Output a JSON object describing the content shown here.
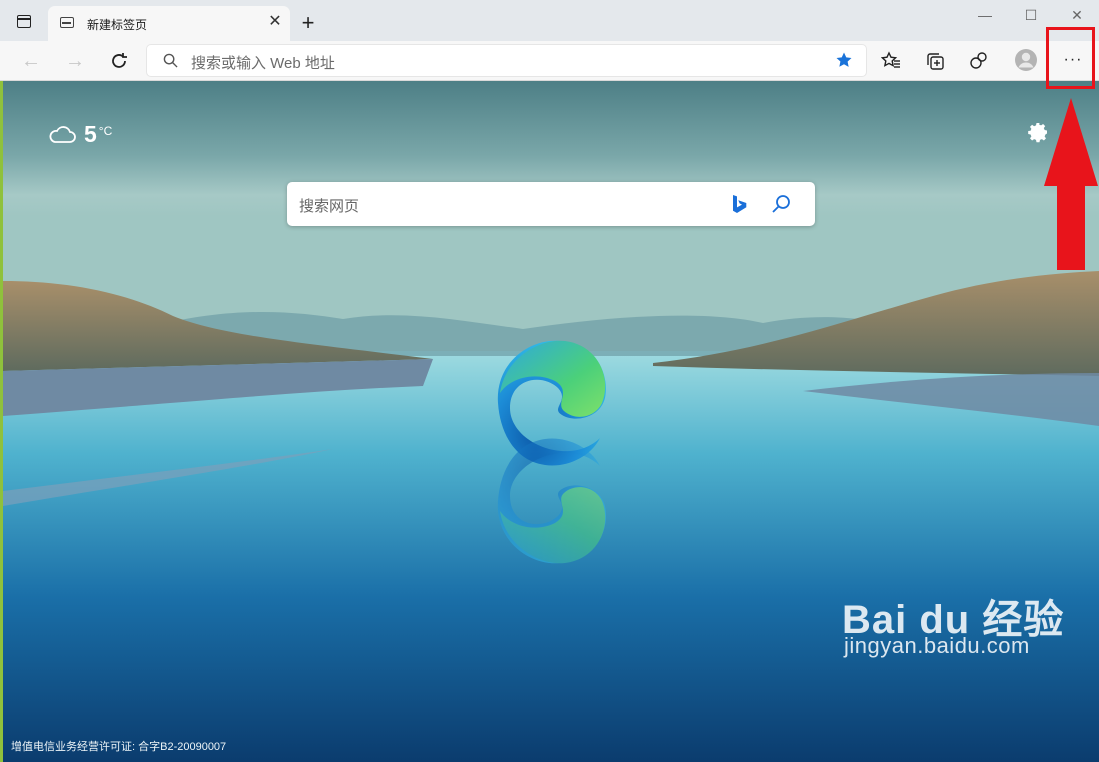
{
  "tab": {
    "title": "新建标签页",
    "close_glyph": "✕",
    "new_tab_glyph": "+"
  },
  "window_controls": {
    "minimize": "—",
    "maximize": "☐",
    "close": "✕"
  },
  "toolbar": {
    "back_glyph": "←",
    "forward_glyph": "→",
    "address_placeholder": "搜索或输入 Web 地址",
    "more_label": "···"
  },
  "newtab_page": {
    "weather": {
      "temperature": "5",
      "unit": "°C"
    },
    "search_placeholder": "搜索网页",
    "license_text": "增值电信业务经营许可证: 合字B2-20090007"
  },
  "watermark": {
    "brand": "Bai du 经验",
    "url": "jingyan.baidu.com"
  },
  "colors": {
    "annotation_red": "#e8141b",
    "edge_blue": "#1b82d8",
    "edge_green": "#4fcc6a"
  }
}
